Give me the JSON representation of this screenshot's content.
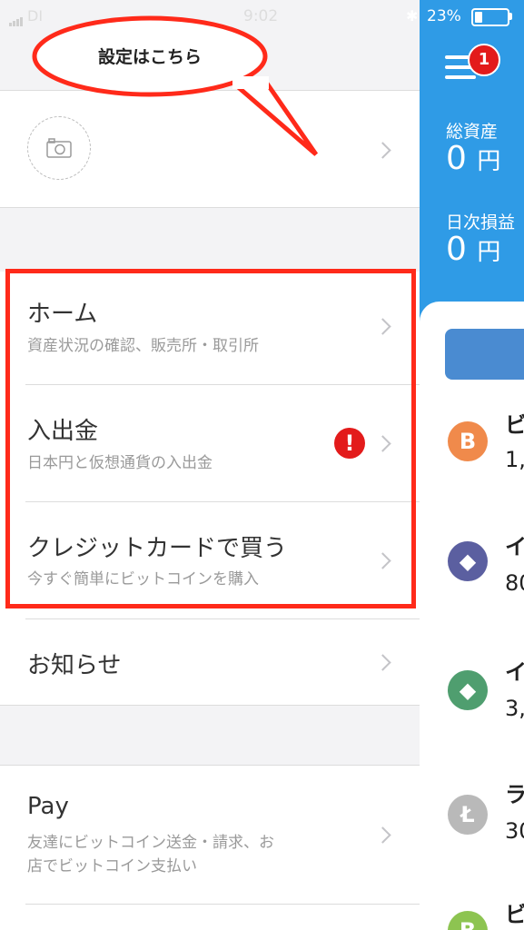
{
  "status_bar": {
    "carrier": "DI",
    "time": "9:02",
    "battery_percent": "23%",
    "battery_level": 0.23
  },
  "callout": {
    "text": "設定はこちら",
    "color": "#ff2a1a"
  },
  "menu": {
    "home": {
      "title": "ホーム",
      "subtitle": "資産状況の確認、販売所・取引所"
    },
    "deposit": {
      "title": "入出金",
      "subtitle": "日本円と仮想通貨の入出金",
      "alert": "!"
    },
    "credit": {
      "title": "クレジットカードで買う",
      "subtitle": "今すぐ簡単にビットコインを購入"
    },
    "news": {
      "title": "お知らせ"
    },
    "pay": {
      "title": "Pay",
      "subtitle_line1": "友達にビットコイン送金・請求、お",
      "subtitle_line2": "店でビットコイン支払い"
    }
  },
  "panel": {
    "menu_badge": "1",
    "total_assets_label": "総資産",
    "total_assets_value": "0",
    "total_assets_unit": "円",
    "daily_pl_label": "日次損益",
    "daily_pl_value": "0",
    "daily_pl_unit": "円",
    "accent_color": "#2f9be6"
  },
  "coins": [
    {
      "icon": "bitcoin-icon",
      "symbol": "B",
      "name": "ビ",
      "value": "1,",
      "color": "#f08a4b"
    },
    {
      "icon": "ethereum-icon",
      "symbol": "◆",
      "name": "イ",
      "value": "80",
      "color": "#5b5fa0"
    },
    {
      "icon": "ethereum-classic-icon",
      "symbol": "◆",
      "name": "イ",
      "value": "3,",
      "color": "#4f9e6f"
    },
    {
      "icon": "litecoin-icon",
      "symbol": "Ł",
      "name": "ラ",
      "value": "30",
      "color": "#b9b9b9"
    },
    {
      "icon": "bitcoin-cash-icon",
      "symbol": "B",
      "name": "ビ",
      "value": "",
      "color": "#8dc451"
    }
  ]
}
